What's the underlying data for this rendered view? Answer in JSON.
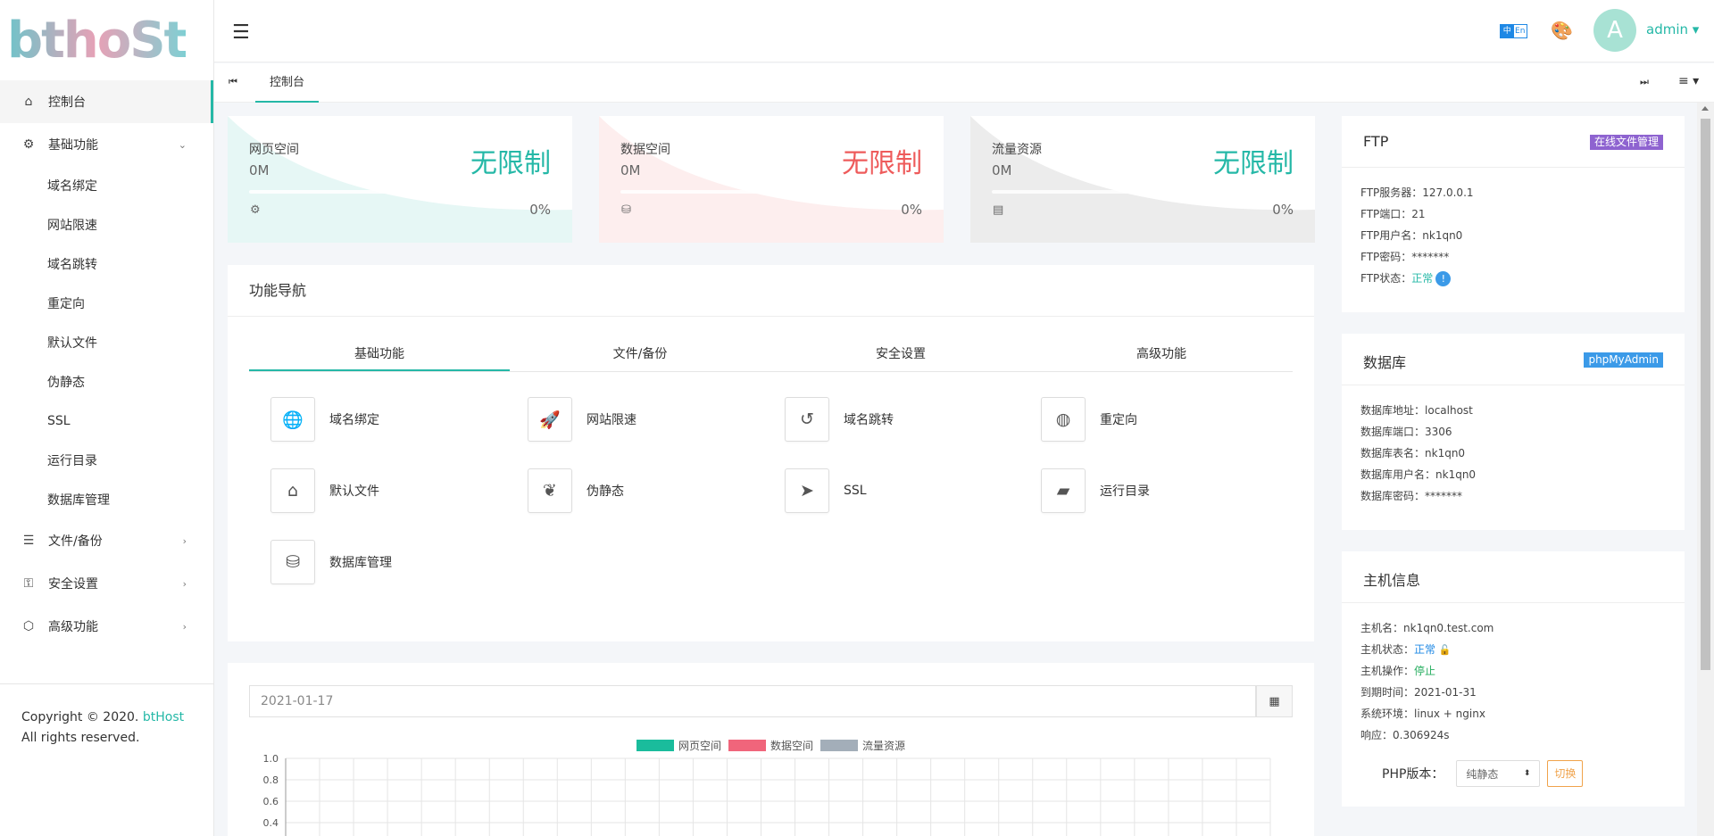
{
  "brand": {
    "logo_text": "bthoSt"
  },
  "sidebar": {
    "items": [
      {
        "label": "控制台",
        "icon": "home-icon"
      },
      {
        "label": "基础功能",
        "icon": "cogs-icon",
        "arrow": "⌄"
      },
      {
        "label": "文件/备份",
        "icon": "list-icon",
        "arrow": "›"
      },
      {
        "label": "安全设置",
        "icon": "shield-settings-icon",
        "arrow": "›"
      },
      {
        "label": "高级功能",
        "icon": "cube-icon",
        "arrow": "›"
      }
    ],
    "sub_items": [
      "域名绑定",
      "网站限速",
      "域名跳转",
      "重定向",
      "默认文件",
      "伪静态",
      "SSL",
      "运行目录",
      "数据库管理"
    ],
    "copyright_prefix": "Copyright © 2020.",
    "copyright_brand": "btHost",
    "copyright_suffix": "All rights reserved."
  },
  "header": {
    "lang_zh": "中",
    "lang_en": "En",
    "avatar_letter": "A",
    "user": "admin ▾"
  },
  "tabbar": {
    "active_tab": "控制台",
    "first_icon": "⏮",
    "last_icon": "⏭",
    "menu_icon": "≡ ▾"
  },
  "stats": [
    {
      "title": "网页空间",
      "used": "0M",
      "value": "无限制",
      "percent": "0%",
      "progress": 0,
      "color": "#25b8a7",
      "bg": "#e6f7f5",
      "icon": "settings-icon"
    },
    {
      "title": "数据空间",
      "used": "0M",
      "value": "无限制",
      "percent": "0%",
      "progress": 0,
      "color": "#ee5b5b",
      "bg": "#fdeeee",
      "icon": "database-icon"
    },
    {
      "title": "流量资源",
      "used": "0M",
      "value": "无限制",
      "percent": "0%",
      "progress": 0,
      "color": "#25b8a7",
      "bg": "#ececec",
      "icon": "server-icon"
    }
  ],
  "feature_nav": {
    "title": "功能导航",
    "tabs": [
      "基础功能",
      "文件/备份",
      "安全设置",
      "高级功能"
    ],
    "items": [
      {
        "label": "域名绑定",
        "icon": "globe-icon"
      },
      {
        "label": "网站限速",
        "icon": "rocket-icon"
      },
      {
        "label": "域名跳转",
        "icon": "undo-icon"
      },
      {
        "label": "重定向",
        "icon": "magnet-icon"
      },
      {
        "label": "默认文件",
        "icon": "home-icon"
      },
      {
        "label": "伪静态",
        "icon": "leaf-icon"
      },
      {
        "label": "SSL",
        "icon": "send-icon"
      },
      {
        "label": "运行目录",
        "icon": "folder-user-icon"
      },
      {
        "label": "数据库管理",
        "icon": "database-icon"
      }
    ]
  },
  "chart_section": {
    "date": "2021-01-17"
  },
  "chart_data": {
    "type": "line",
    "series": [
      {
        "name": "网页空间",
        "color": "#1abc9c",
        "values": []
      },
      {
        "name": "数据空间",
        "color": "#f0657b",
        "values": []
      },
      {
        "name": "流量资源",
        "color": "#a3aeb9",
        "values": []
      }
    ],
    "y_ticks": [
      "1.0",
      "0.8",
      "0.6",
      "0.4"
    ],
    "ylim": [
      0,
      1
    ],
    "grid": true
  },
  "ftp": {
    "title": "FTP",
    "badge": "在线文件管理",
    "badge_color": "#8e63d0",
    "server_label": "FTP服务器：",
    "server": "127.0.0.1",
    "port_label": "FTP端口：",
    "port": "21",
    "user_label": "FTP用户名：",
    "user": "nk1qn0",
    "pass_label": "FTP密码：",
    "pass": "*******",
    "status_label": "FTP状态：",
    "status": "正常",
    "status_icon": "!"
  },
  "database": {
    "title": "数据库",
    "badge": "phpMyAdmin",
    "badge_color": "#3b9ae8",
    "host_label": "数据库地址：",
    "host": "localhost",
    "port_label": "数据库端口：",
    "port": "3306",
    "name_label": "数据库表名：",
    "name": "nk1qn0",
    "user_label": "数据库用户名：",
    "user": "nk1qn0",
    "pass_label": "数据库密码：",
    "pass": "*******"
  },
  "host": {
    "title": "主机信息",
    "name_label": "主机名：",
    "name": "nk1qn0.test.com",
    "status_label": "主机状态：",
    "status": "正常",
    "op_label": "主机操作：",
    "op": "停止",
    "expire_label": "到期时间：",
    "expire": "2021-01-31",
    "env_label": "系统环境：",
    "env": "linux + nginx",
    "resp_label": "响应：",
    "resp": "0.306924s",
    "php_label": "PHP版本：",
    "php_value": "纯静态",
    "switch_label": "切换"
  }
}
